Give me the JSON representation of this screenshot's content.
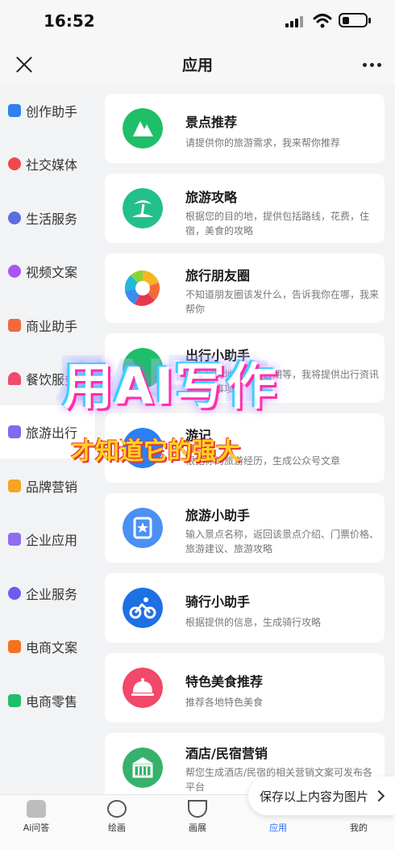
{
  "status": {
    "time": "16:52"
  },
  "header": {
    "title": "应用"
  },
  "sidebar": {
    "items": [
      {
        "label": "创作助手",
        "color": "#2f80ed"
      },
      {
        "label": "社交媒体",
        "color": "#f2484b"
      },
      {
        "label": "生活服务",
        "color": "#5b6ee1"
      },
      {
        "label": "视频文案",
        "color": "#a855f7"
      },
      {
        "label": "商业助手",
        "color": "#f26a3b"
      },
      {
        "label": "餐饮服务",
        "color": "#ef4b6c"
      },
      {
        "label": "旅游出行",
        "color": "#7b6cf0",
        "active": true
      },
      {
        "label": "品牌营销",
        "color": "#f5a623"
      },
      {
        "label": "企业应用",
        "color": "#8e6cf0"
      },
      {
        "label": "企业服务",
        "color": "#6a5cf0"
      },
      {
        "label": "电商文案",
        "color": "#f5731f"
      },
      {
        "label": "电商零售",
        "color": "#1fbf6a"
      }
    ]
  },
  "cards": [
    {
      "title": "景点推荐",
      "desc": "请提供你的旅游需求，我来帮你推荐",
      "icon": "mountain-icon",
      "color": "#1fbf6a"
    },
    {
      "title": "旅游攻略",
      "desc": "根据您的目的地，提供包括路线，花费，住宿，美食的攻略",
      "icon": "palm-island-icon",
      "color": "#22c08a"
    },
    {
      "title": "旅行朋友圈",
      "desc": "不知道朋友圈该发什么，告诉我你在哪，我来帮你",
      "icon": "aperture-icon",
      "color": "#ffffff"
    },
    {
      "title": "出行小助手",
      "desc": "输入目的地、出发日期等，我将提供出行资讯及注意事项",
      "icon": "travel-icon",
      "color": "#1fbf6a"
    },
    {
      "title": "游记",
      "desc": "根据你的旅游经历，生成公众号文章",
      "icon": "note-icon",
      "color": "#2b7ff5"
    },
    {
      "title": "旅游小助手",
      "desc": "输入景点名称，返回该景点介绍、门票价格、旅游建议、旅游攻略",
      "icon": "star-book-icon",
      "color": "#4a90f5"
    },
    {
      "title": "骑行小助手",
      "desc": "根据提供的信息，生成骑行攻略",
      "icon": "bike-icon",
      "color": "#1f6fe5"
    },
    {
      "title": "特色美食推荐",
      "desc": "推荐各地特色美食",
      "icon": "cloche-icon",
      "color": "#f2486a"
    },
    {
      "title": "酒店/民宿营销",
      "desc": "帮您生成酒店/民宿的相关营销文案可发布各平台",
      "icon": "building-icon",
      "color": "#37b26c"
    }
  ],
  "promo": {
    "headline": "用AI写作",
    "subline": "才知道它的强大"
  },
  "save_button": {
    "label": "保存以上内容为图片"
  },
  "tabbar": {
    "items": [
      {
        "label": "Ai问答"
      },
      {
        "label": "绘画"
      },
      {
        "label": "画展"
      },
      {
        "label": "应用",
        "active": true
      },
      {
        "label": "我的"
      }
    ]
  }
}
